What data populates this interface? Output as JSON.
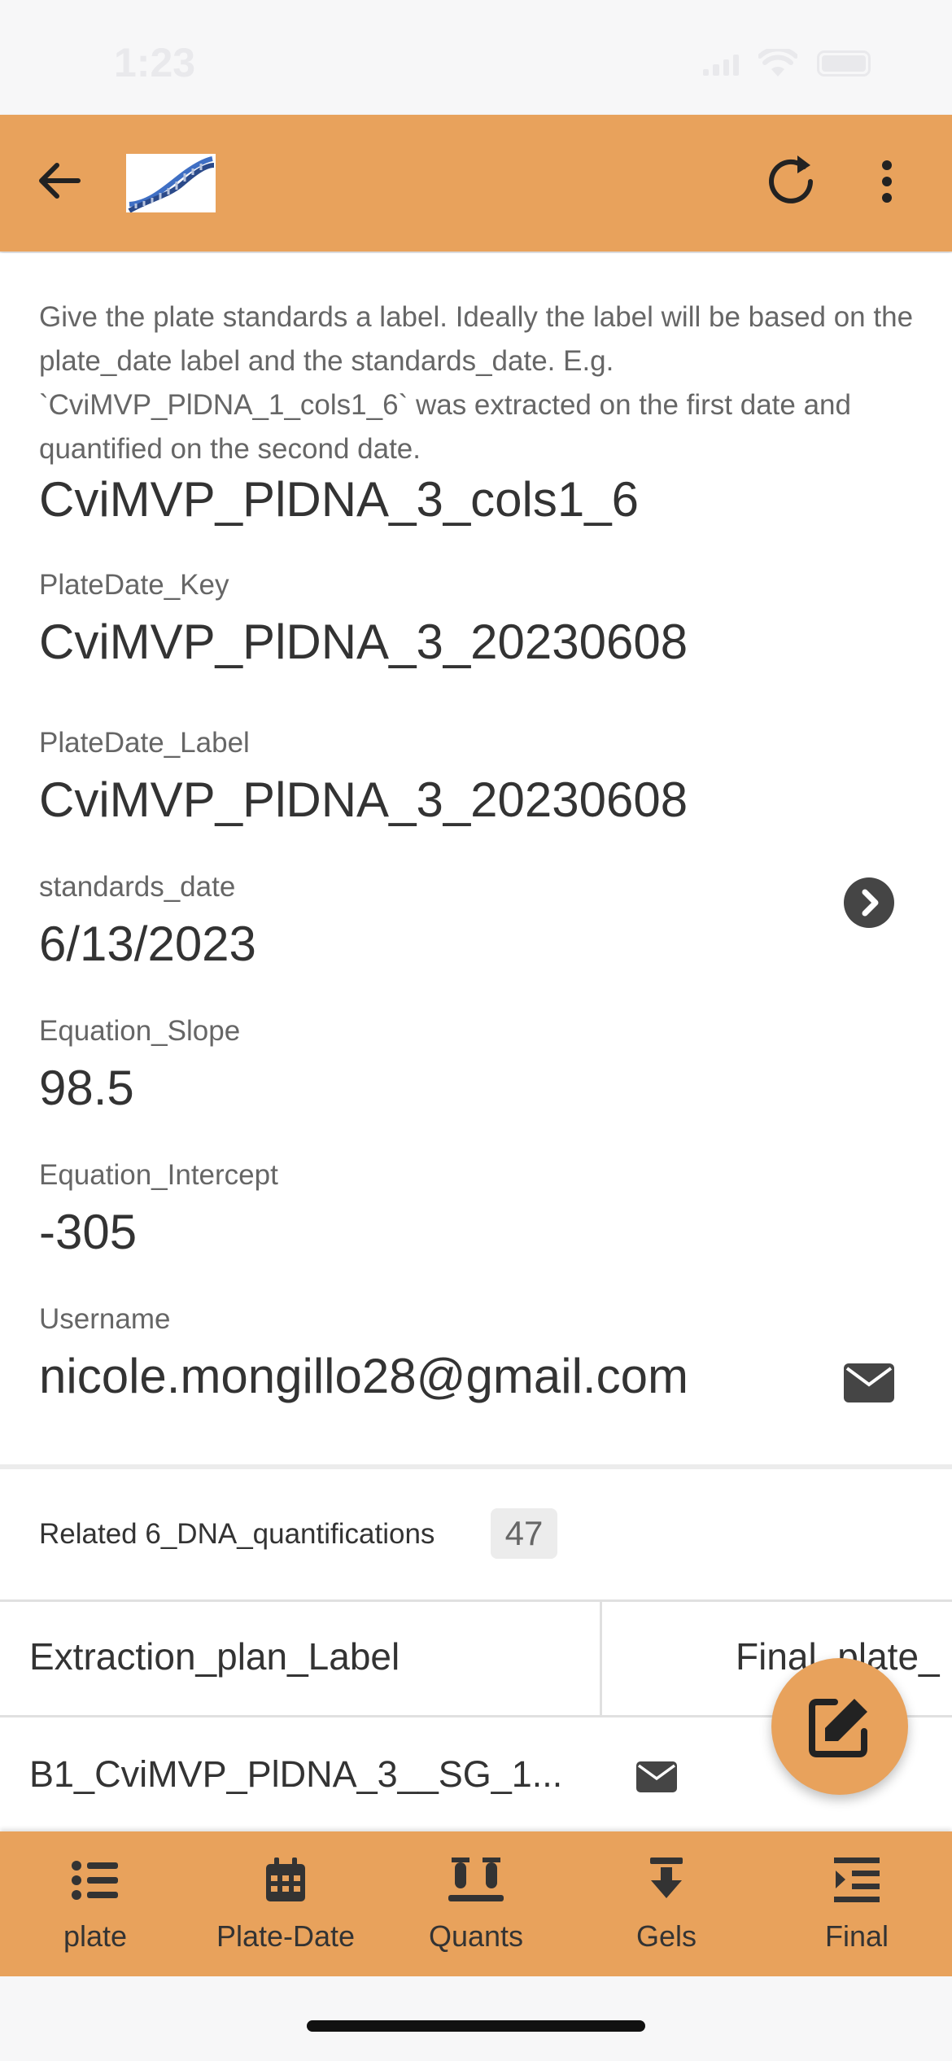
{
  "status_bar": {
    "time": "1:23"
  },
  "app_bar": {
    "logo_icon": "dna-helix-logo",
    "back_icon": "arrow-left-icon",
    "refresh_icon": "refresh-icon",
    "more_icon": "more-vertical-icon"
  },
  "record": {
    "description": "Give the plate standards a label. Ideally the label will be based on the plate_date label and the standards_date. E.g. `CviMVP_PlDNA_1_cols1_6` was extracted on the first date and quantified on the second date.",
    "label_value": "CviMVP_PlDNA_3_cols1_6",
    "fields": [
      {
        "label": "PlateDate_Key",
        "value": "CviMVP_PlDNA_3_20230608"
      },
      {
        "label": "PlateDate_Label",
        "value": "CviMVP_PlDNA_3_20230608"
      },
      {
        "label": "standards_date",
        "value": "6/13/2023"
      },
      {
        "label": "Equation_Slope",
        "value": "98.5"
      },
      {
        "label": "Equation_Intercept",
        "value": "-305"
      },
      {
        "label": "Username",
        "value": "nicole.mongillo28@gmail.com"
      }
    ]
  },
  "related": {
    "label": "Related 6_DNA_quantifications",
    "count": "47",
    "columns": [
      "Extraction_plan_Label",
      "Final_plate_"
    ],
    "rows": [
      {
        "extraction_plan_label": "B1_CviMVP_PlDNA_3__SG_1..."
      }
    ]
  },
  "bottom_nav": [
    {
      "label": "plate",
      "icon": "list-icon"
    },
    {
      "label": "Plate-Date",
      "icon": "calendar-icon"
    },
    {
      "label": "Quants",
      "icon": "vials-icon"
    },
    {
      "label": "Gels",
      "icon": "download-icon"
    },
    {
      "label": "Final",
      "icon": "indent-icon"
    }
  ],
  "colors": {
    "accent": "#e8a25c",
    "text": "#333333",
    "label": "#666666",
    "background": "#ffffff"
  }
}
